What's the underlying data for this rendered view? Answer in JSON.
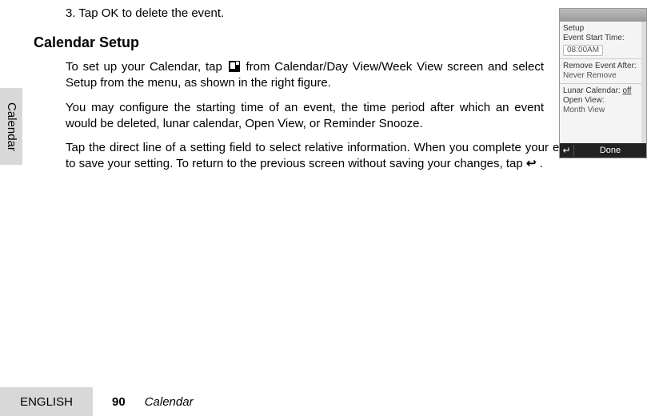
{
  "body": {
    "step3": "3. Tap OK to delete the event.",
    "heading": "Calendar Setup",
    "para1_pre": "To set up your Calendar, tap ",
    "para1_post": " from Calendar/Day View/Week View screen and select Setup from the menu, as shown in the right figure.",
    "para2": "You may configure the starting time of an event, the time period after which an event would be deleted, lunar calendar, Open View, or Reminder Snooze.",
    "para3_pre": "Tap the direct line of a setting field to select relative information. When you complete your entry, tap Done to save your setting. To return to the previous screen without saving your changes, tap ",
    "para3_post": " ."
  },
  "side_tab": "Calendar",
  "footer": {
    "lang": "ENGLISH",
    "page": "90",
    "section": "Calendar"
  },
  "phone": {
    "setup_label": "Setup",
    "event_start_label": "Event Start Time:",
    "event_start_value": "08:00AM",
    "remove_label": "Remove Event After:",
    "remove_value": "Never Remove",
    "lunar_label": "Lunar Calendar:",
    "lunar_value": "off",
    "openview_label": "Open View:",
    "openview_value": "Month View",
    "done": "Done",
    "back_glyph": "↵"
  },
  "glyphs": {
    "back_arrow": "↩"
  }
}
